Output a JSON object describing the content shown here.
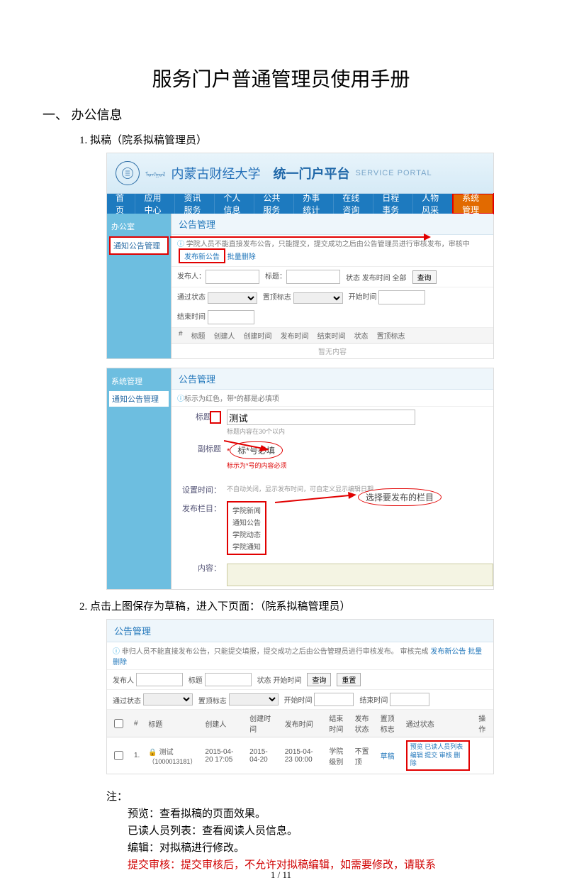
{
  "doc": {
    "title": "服务门户普通管理员使用手册",
    "section1_head": "一、 办公信息",
    "item1": "1. 拟稿（院系拟稿管理员）",
    "item2": "2. 点击上图保存为草稿，进入下页面：（院系拟稿管理员）",
    "note_lead": "注：",
    "note1": "预览：查看拟稿的页面效果。",
    "note2": "已读人员列表：查看阅读人员信息。",
    "note3": "编辑：对拟稿进行修改。",
    "note4": "提交审核：提交审核后，不允许对拟稿编辑，如需要修改，请联系",
    "page_num": "1  /  11"
  },
  "ss1": {
    "uni_name": "内蒙古财经大学",
    "portal": "统一门户平台",
    "portal_en": "SERVICE PORTAL",
    "nav": [
      "首页",
      "应用中心",
      "资讯服务",
      "个人信息",
      "公共服务",
      "办事统计",
      "在线咨询",
      "日程事务",
      "人物风采",
      "系统管理"
    ],
    "side_head": "办公室",
    "side_item": "通知公告管理",
    "panel_head": "公告管理",
    "panel_sub_pre": "学院人员不能直接发布公告，只能提交，提交成功之后由公告管理员进行审核发布，审核中 ",
    "pub_btn": "发布新公告",
    "pub_btn2": " 批量删除",
    "filter_labels": {
      "pub": "发布人：",
      "title": "标题：",
      "state": "状态 发布时间 全部",
      "qd": "查询",
      "state2": "通过状态",
      "top": "置顶标志",
      "from": "开始时间",
      "to": "结束时间"
    },
    "th": [
      "#",
      "标题",
      "创建人",
      "创建时间",
      "发布时间",
      "结束时间",
      "状态",
      "置顶标志"
    ],
    "empty": "暂无内容"
  },
  "ss2": {
    "side_head": "系统管理",
    "side_item": "通知公告管理",
    "panel_head": "公告管理",
    "panel_sub": "标示为红色，带*的都是必填项",
    "label_title": "标题",
    "hint_title": "标题内容在30个以内",
    "title_val": "测试",
    "label_sub": "副标题",
    "hint_sub": "标示为*号的内容必须",
    "callout1": "标*号必填",
    "label_time": "设置时间：",
    "time_hint": "不自动关闭，显示发布时间，可自定义显示编辑日期",
    "label_col": "发布栏目：",
    "options": [
      "学院新闻",
      "通知公告",
      "学院动态",
      "学院通知"
    ],
    "callout2": "选择要发布的栏目",
    "label_content": "内容："
  },
  "ss3": {
    "panel_head": "公告管理",
    "panel_sub_pre": "非归人员不能直接发布公告，只能提交填报，提交成功之后由公告管理员进行审核发布。 审核完成 ",
    "pub_btn": "发布新公告",
    "pub_btn2": " 批量删除",
    "f_pub": "发布人",
    "f_title": "标题",
    "f_state": "状态",
    "f_start": "开始时间",
    "f_top": "置顶标志",
    "f_pass": "通过状态",
    "f_end": "结束时间",
    "btn_query": "查询",
    "btn_reset": "重置",
    "th": [
      "",
      "#",
      "标题",
      "创建人",
      "创建时间",
      "发布时间",
      "结束时间",
      "发布状态",
      "置顶标志",
      "通过状态",
      "操作"
    ],
    "row": {
      "idx": "1.",
      "title": "测试",
      "creator": "（1000013181）",
      "c_date": "2015-04-20 17:05",
      "p_date": "2015-04-20",
      "e_date": "2015-04-23 00:00",
      "state": "学院级别",
      "top": "不置顶",
      "pass": "草稿",
      "ops": "预览 已读人员列表 编辑 提交 审核 删除"
    }
  }
}
